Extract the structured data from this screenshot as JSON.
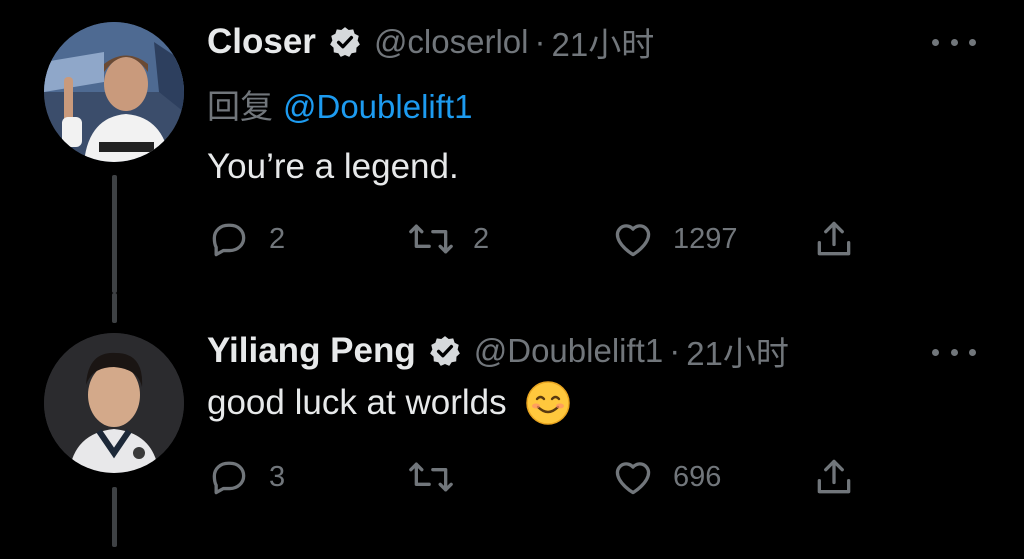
{
  "tweets": [
    {
      "display_name": "Closer",
      "handle": "@closerlol",
      "separator": "·",
      "time": "21小时",
      "reply_prefix": "回复",
      "reply_to": "@Doublelift1",
      "text": "You’re a legend.",
      "replies": "2",
      "retweets": "2",
      "likes": "1297"
    },
    {
      "display_name": "Yiliang Peng",
      "handle": "@Doublelift1",
      "separator": "·",
      "time": "21小时",
      "text": "good luck at worlds",
      "emoji": "smiling-face-emoji",
      "replies": "3",
      "retweets": "",
      "likes": "696"
    }
  ],
  "colors": {
    "background": "#000000",
    "primary_text": "#e7e9ea",
    "secondary_text": "#71767b",
    "link": "#1d9bf0",
    "thread_line": "#3e4144"
  }
}
